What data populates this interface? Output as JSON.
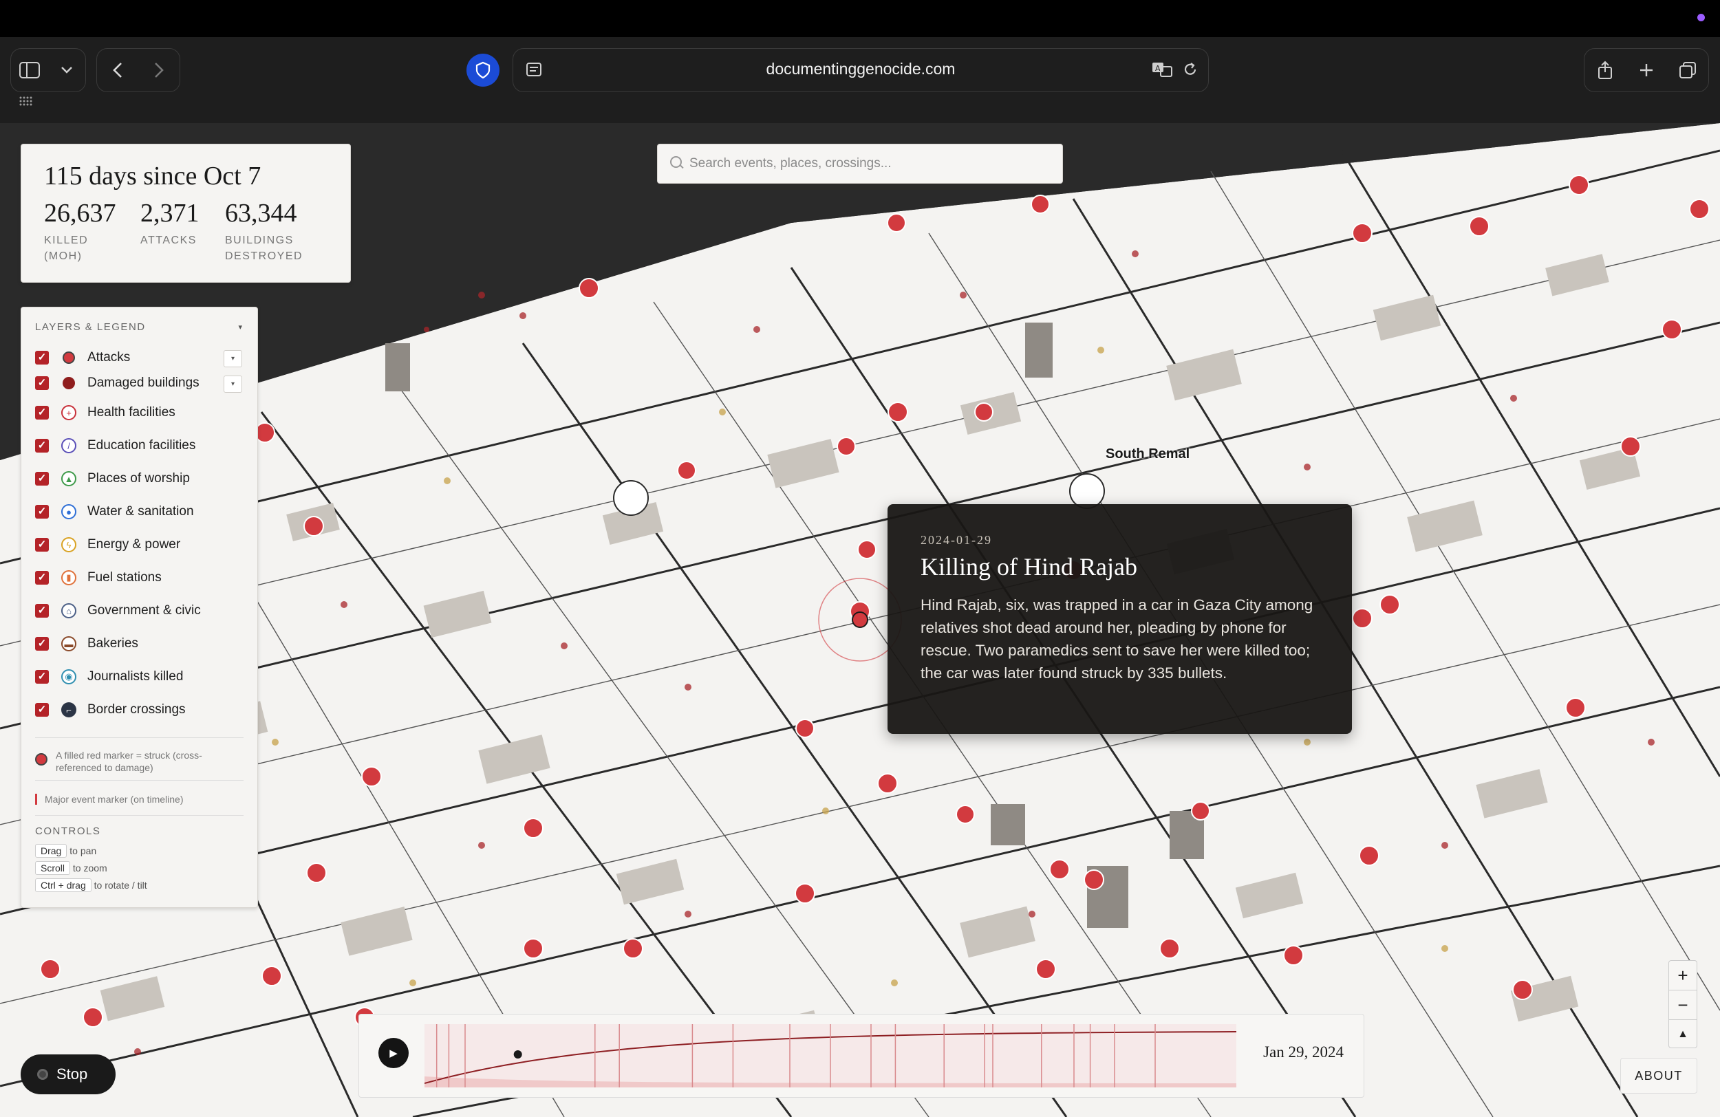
{
  "browser": {
    "url": "documentinggenocide.com",
    "icons": [
      "sidebar-icon",
      "chevron-down-icon",
      "back-icon",
      "forward-icon",
      "shield-icon",
      "reader-icon",
      "translate-icon",
      "reload-icon",
      "share-icon",
      "plus-icon",
      "tabs-icon",
      "grid-icon"
    ]
  },
  "stats": {
    "title": "115 days since Oct 7",
    "items": [
      {
        "value": "26,637",
        "label": "KILLED (MOH)"
      },
      {
        "value": "2,371",
        "label": "ATTACKS"
      },
      {
        "value": "63,344",
        "label": "BUILDINGS DESTROYED"
      }
    ]
  },
  "search": {
    "placeholder": "Search events, places, crossings..."
  },
  "legend": {
    "heading": "LAYERS & LEGEND",
    "layers": [
      {
        "label": "Attacks",
        "icon": "attack-icon",
        "color": "#d23a3f",
        "checked": true
      },
      {
        "label": "Damaged buildings",
        "icon": "damaged-building-icon",
        "color": "#8f1d1d",
        "checked": true
      },
      {
        "label": "Health facilities",
        "icon": "health-cross-icon",
        "color": "#c8303a",
        "checked": true
      },
      {
        "label": "Education facilities",
        "icon": "pencil-icon",
        "color": "#5a4fb8",
        "checked": true
      },
      {
        "label": "Places of worship",
        "icon": "mosque-icon",
        "color": "#3e9a4a",
        "checked": true
      },
      {
        "label": "Water & sanitation",
        "icon": "water-drop-icon",
        "color": "#2f6fd6",
        "checked": true
      },
      {
        "label": "Energy & power",
        "icon": "lightning-icon",
        "color": "#d9a222",
        "checked": true
      },
      {
        "label": "Fuel stations",
        "icon": "fuel-icon",
        "color": "#e0713a",
        "checked": true
      },
      {
        "label": "Government & civic",
        "icon": "civic-building-icon",
        "color": "#4b5f86",
        "checked": true
      },
      {
        "label": "Bakeries",
        "icon": "bread-icon",
        "color": "#8a4a2a",
        "checked": true
      },
      {
        "label": "Journalists killed",
        "icon": "camera-icon",
        "color": "#2f8fb0",
        "checked": true
      },
      {
        "label": "Border crossings",
        "icon": "gate-icon",
        "color": "#2b3445",
        "checked": true
      }
    ],
    "note_struck": "A filled red marker = struck (cross-referenced to damage)",
    "note_major": "Major event marker (on timeline)",
    "controls_heading": "CONTROLS",
    "controls": [
      {
        "key": "Drag",
        "action": "to pan"
      },
      {
        "key": "Scroll",
        "action": "to zoom"
      },
      {
        "key": "Ctrl + drag",
        "action": "to rotate / tilt"
      }
    ]
  },
  "map": {
    "place_label": "South Remal"
  },
  "event": {
    "date": "2024-01-29",
    "title": "Killing of Hind Rajab",
    "body": "Hind Rajab, six, was trapped in a car in Gaza City among relatives shot dead around her, pleading by phone for rescue. Two paramedics sent to save her were killed too; the car was later found struck by 335 bullets."
  },
  "timeline": {
    "date_label": "Jan 29, 2024",
    "progress": 0.115
  },
  "controls": {
    "stop_label": "Stop",
    "about_label": "ABOUT"
  }
}
